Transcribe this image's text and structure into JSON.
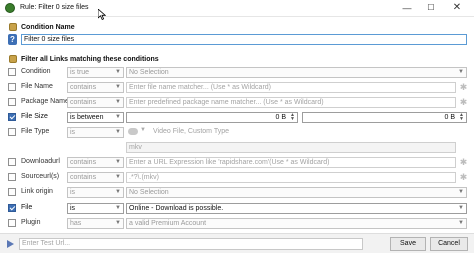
{
  "window": {
    "title": "Rule: Filter 0 size files"
  },
  "condition_name": {
    "heading": "Condition Name",
    "value": "Filter 0 size files"
  },
  "filter_heading": "Filter all Links matching these conditions",
  "rows": {
    "condition": {
      "label": "Condition",
      "op": "is true",
      "value": "No Selection",
      "checked": false
    },
    "filename": {
      "label": "File Name",
      "op": "contains",
      "value": "Enter file name matcher... (Use * as Wildcard)",
      "checked": false
    },
    "package": {
      "label": "Package Name",
      "op": "contains",
      "value": "Enter predefined package name matcher... (Use * as Wildcard)",
      "checked": false
    },
    "filesize": {
      "label": "File Size",
      "op": "is between",
      "value_from": "0 B",
      "value_to": "0 B",
      "checked": true
    },
    "filetype": {
      "label": "File Type",
      "op": "is",
      "value": "Video File, Custom Type",
      "custom": "mkv",
      "checked": false
    },
    "downloadurl": {
      "label": "Downloadurl",
      "op": "contains",
      "value": "Enter a URL Expression like 'rapidshare.com'(Use * as Wildcard)",
      "checked": false
    },
    "sourceurls": {
      "label": "Sourceurl(s)",
      "op": "contains",
      "value": ".*?\\.(mkv)",
      "checked": false
    },
    "linkorigin": {
      "label": "Link origin",
      "op": "is",
      "value": "No Selection",
      "checked": false
    },
    "file": {
      "label": "File",
      "op": "is",
      "value": "Online - Download is possible.",
      "checked": true
    },
    "plugin": {
      "label": "Plugin",
      "op": "has",
      "value": "a valid Premium Account",
      "checked": false
    }
  },
  "bottom": {
    "test_placeholder": "Enter Test Url...",
    "save_label": "Save",
    "cancel_label": "Cancel"
  },
  "icons": {
    "app": "app-icon",
    "help": "help-icon",
    "wildcard": "wildcard-star-icon",
    "test": "play-icon"
  },
  "colors": {
    "accent": "#3d6fb5",
    "focus_border": "#5b9bd5"
  }
}
